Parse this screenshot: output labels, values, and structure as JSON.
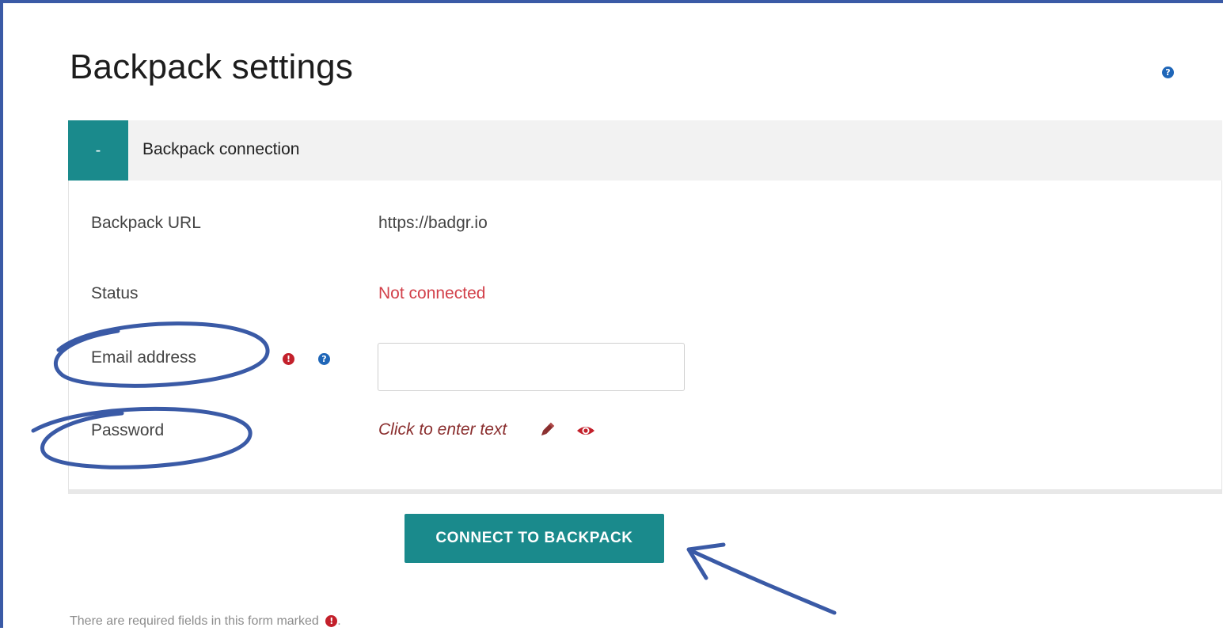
{
  "page": {
    "title": "Backpack settings",
    "help_icon": "question-circle-icon"
  },
  "fieldset": {
    "toggle_label": "-",
    "legend": "Backpack connection"
  },
  "rows": {
    "backpack_url": {
      "label": "Backpack URL",
      "value": "https://badgr.io"
    },
    "status": {
      "label": "Status",
      "value": "Not connected"
    },
    "email": {
      "label": "Email address",
      "value": "",
      "placeholder": ""
    },
    "password": {
      "label": "Password",
      "value": "Click to enter text"
    }
  },
  "icons": {
    "required": "exclamation-circle-icon",
    "help": "question-circle-icon",
    "edit": "pencil-icon",
    "reveal": "eye-icon"
  },
  "actions": {
    "connect_label": "CONNECT TO BACKPACK"
  },
  "footer": {
    "required_note": "There are required fields in this form marked",
    "required_note_end": "."
  },
  "colors": {
    "accent": "#1a8a8c",
    "error": "#c3202b",
    "help": "#1f66b8",
    "status_error": "#d2404a",
    "annotation": "#3a5aa6"
  }
}
